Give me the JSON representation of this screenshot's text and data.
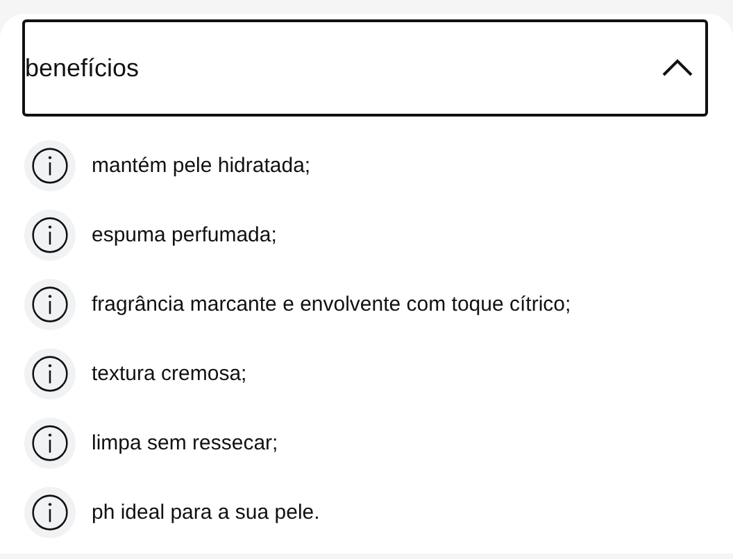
{
  "accordion": {
    "title": "benefícios",
    "expanded": true,
    "items": [
      {
        "text": "mantém pele hidratada;"
      },
      {
        "text": "espuma perfumada;"
      },
      {
        "text": "fragrância marcante e envolvente com toque cítrico;"
      },
      {
        "text": "textura cremosa;"
      },
      {
        "text": "limpa sem ressecar;"
      },
      {
        "text": "ph ideal para a sua pele."
      }
    ]
  }
}
